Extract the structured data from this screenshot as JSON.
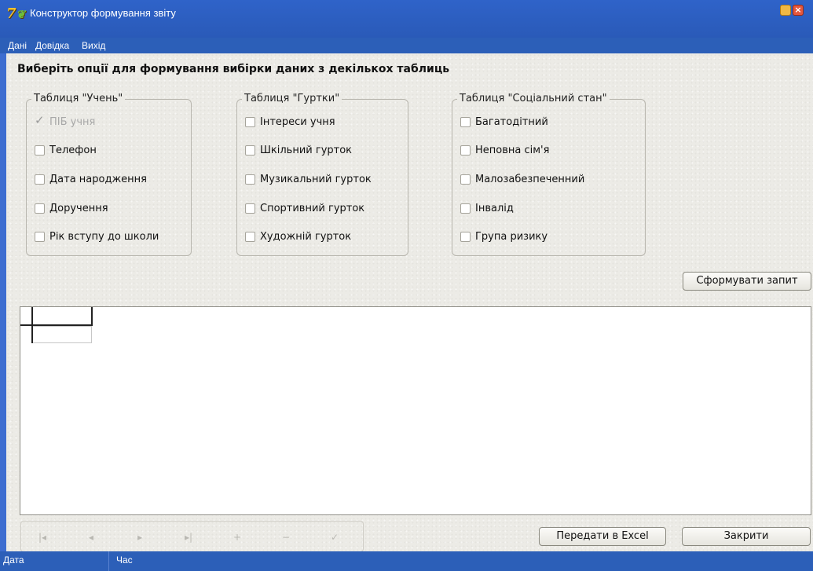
{
  "window": {
    "title": "Конструктор формування звіту"
  },
  "menu": {
    "items": [
      "Дані",
      "Довідка",
      "Вихід"
    ]
  },
  "heading": "Виберіть опції для формування вибірки даних з декількох таблиць",
  "groups": [
    {
      "title": "Таблиця \"Учень\"",
      "options": [
        {
          "label": "ПІБ учня",
          "checked": true,
          "disabled": true
        },
        {
          "label": "Телефон",
          "checked": false,
          "disabled": false
        },
        {
          "label": "Дата народження",
          "checked": false,
          "disabled": false
        },
        {
          "label": "Доручення",
          "checked": false,
          "disabled": false
        },
        {
          "label": "Рік вступу до школи",
          "checked": false,
          "disabled": false
        }
      ]
    },
    {
      "title": "Таблиця \"Гуртки\"",
      "options": [
        {
          "label": "Інтереси учня",
          "checked": false,
          "disabled": false
        },
        {
          "label": "Шкільний гурток",
          "checked": false,
          "disabled": false
        },
        {
          "label": "Музикальний гурток",
          "checked": false,
          "disabled": false
        },
        {
          "label": "Спортивний гурток",
          "checked": false,
          "disabled": false
        },
        {
          "label": "Художній гурток",
          "checked": false,
          "disabled": false
        }
      ]
    },
    {
      "title": "Таблиця \"Соціальний стан\"",
      "options": [
        {
          "label": "Багатодітний",
          "checked": false,
          "disabled": false
        },
        {
          "label": "Неповна сім'я",
          "checked": false,
          "disabled": false
        },
        {
          "label": "Малозабезпеченний",
          "checked": false,
          "disabled": false
        },
        {
          "label": "Інвалід",
          "checked": false,
          "disabled": false
        },
        {
          "label": "Група ризику",
          "checked": false,
          "disabled": false
        }
      ]
    }
  ],
  "buttons": {
    "build_query": "Сформувати запит",
    "export_excel": "Передати в Excel",
    "close": "Закрити"
  },
  "navigator": {
    "first": "|◂",
    "prior": "◂",
    "next": "▸",
    "last": "▸|",
    "insert": "+",
    "delete": "−",
    "post": "✓"
  },
  "status": {
    "date_label": "Дата",
    "time_label": "Час"
  },
  "colors": {
    "titlebar": "#2c5fb8",
    "client_bg": "#ecebe6"
  }
}
